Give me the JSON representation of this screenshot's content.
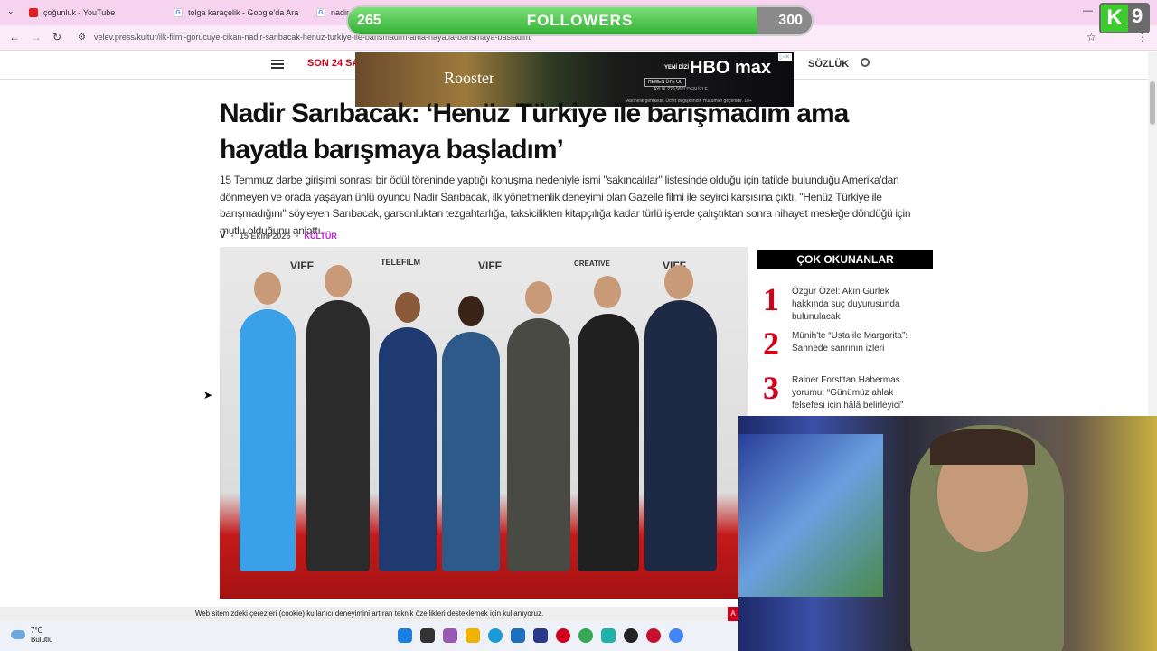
{
  "browser": {
    "tabs": [
      {
        "label": "çoğunluk - YouTube"
      },
      {
        "label": "tolga karaçelik - Google'da Ara"
      },
      {
        "label": "nadir"
      }
    ],
    "url": "velev.press/kultur/ilk-filmi-gorucuye-cikan-nadir-saribacak-henuz-turkiye-ile-barismadim-ama-hayatla-barismaya-basladim/"
  },
  "site": {
    "son24": "SON 24 SAAT",
    "sozluk": "SÖZLÜK"
  },
  "ad": {
    "title": "Rooster",
    "yeni_dizi": "YENİ DİZİ",
    "brand": "HBO max",
    "cta": "HEMEN ÜYE OL",
    "price": "AYLIK 229,99TL'DEN İZLE",
    "fine": "Abonelik gereklidir. Ücret değişkendir. Hükümler geçerlidir. 18+"
  },
  "article": {
    "headline": "Nadir Sarıbacak: ‘Henüz Türkiye ile barışmadım ama hayatla barışmaya başladım’",
    "lede": "15 Temmuz darbe girişimi sonrası bir ödül töreninde yaptığı konuşma nedeniyle ismi \"sakıncalılar\" listesinde olduğu için tatilde bulunduğu Amerika'dan dönmeyen ve orada yaşayan ünlü oyuncu Nadir Sarıbacak, ilk yönetmenlik deneyimi olan Gazelle filmi ile seyirci karşısına çıktı. \"Henüz Türkiye ile barışmadığını\" söyleyen Sarıbacak, garsonluktan tezgahtarlığa, taksicilikten kitapçılığa kadar türlü işlerde çalıştıktan sonra nihayet mesleğe döndüğü için mutlu olduğunu anlattı.",
    "date": "15 Ekim 2025",
    "category": "KÜLTÜR",
    "wall_labels": [
      "VIFF",
      "TELEFILM",
      "VIFF",
      "VIFF",
      "CREATIVE"
    ]
  },
  "sidebar": {
    "title": "ÇOK OKUNANLAR",
    "items": [
      {
        "num": "1",
        "text": "Özgür Özel: Akın Gürlek hakkında suç duyurusunda bulunulacak"
      },
      {
        "num": "2",
        "text": "Münih'te “Usta ile Margarita”: Sahnede sanrının izleri"
      },
      {
        "num": "3",
        "text": "Rainer Forst'tan Habermas yorumu: “Günümüz ahlak felsefesi için hâlâ belirleyici”"
      }
    ]
  },
  "cookie": {
    "text": "Web sitemizdeki çerezleri (cookie) kullanıcı deneyimini artıran teknik özellikleri desteklemek için kullanıyoruz.",
    "accept": "A"
  },
  "taskbar": {
    "temp": "7°C",
    "condition": "Bulutlu"
  },
  "overlay": {
    "current": "265",
    "label": "FOLLOWERS",
    "goal": "300",
    "progress": 0.883,
    "badge_letter": "K",
    "badge_num": "9"
  }
}
